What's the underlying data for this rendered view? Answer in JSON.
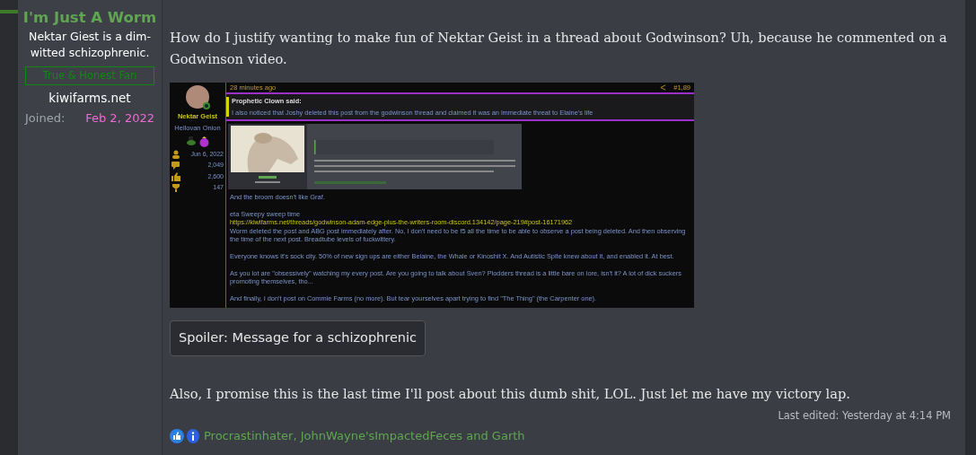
{
  "user": {
    "title": "I'm Just A Worm",
    "custom_title": "Nektar Giest is a dim-witted schizophrenic.",
    "banner": "True & Honest Fan",
    "website": "kiwifarms.net",
    "joined_label": "Joined:",
    "joined_value": "Feb 2, 2022"
  },
  "post": {
    "paragraphs": [
      "How do I justify wanting to make fun of Nektar Geist in a thread about Godwinson? Uh, because he commented on a Godwinson video."
    ],
    "embed": {
      "time": "28 minutes ago",
      "post_number": "#1,89",
      "author": "Nektar Geist",
      "author_title": "Hellovan Onion",
      "stats": [
        "Jun 6, 2022",
        "2,049",
        "2,600",
        "147"
      ],
      "quote": {
        "author": "Prophetic Clown said:",
        "text": "I also noticed that Joshy deleted this post from the godwinson thread and claimed it was an immediate threat to Elaine's life"
      },
      "body": [
        {
          "kind": "text",
          "text": "And the broom doesn't like Graf."
        },
        {
          "kind": "gap"
        },
        {
          "kind": "text",
          "text": "eta Sweepy sweep time"
        },
        {
          "kind": "link",
          "text": "https://kiwifarms.net/threads/godwinson-adam-edge-plus-the-writers-room-discord.134142/page-219#post-16171962"
        },
        {
          "kind": "text",
          "text": "Worm deleted the post and ABG post immediately after. No, I don't need to be f5 all the time to be able to observe a post being deleted. And then observing the time of the next post. Breadtube levels of fuckwittery."
        },
        {
          "kind": "gap"
        },
        {
          "kind": "text",
          "text": "Everyone knows it's sock city. 50% of new sign ups are either Belaine, the Whale or Kinoshit X. And Autistic Spite knew about it, and enabled it. At best."
        },
        {
          "kind": "gap"
        },
        {
          "kind": "text",
          "text": "As you lot are \"obsessively\" watching my every post. Are you going to talk about Sven? Plodders thread is a little bare on lore, isn't it? A lot of dick suckers promoting themselves, tho..."
        },
        {
          "kind": "gap"
        },
        {
          "kind": "text",
          "text": "And finally, I don't post on Commie Farms (no more). But tear yourselves apart trying to find \"The Thing\" (the Carpenter one)."
        }
      ]
    },
    "spoiler": "Spoiler: Message for a schizophrenic",
    "closing": "Also, I promise this is the last time I'll post about this dumb shit, LOL. Just let me have my victory lap.",
    "last_edited": "Last edited: Yesterday at 4:14 PM",
    "reactions": "Procrastinhater, JohnWayne'sImpactedFeces and Garth"
  }
}
